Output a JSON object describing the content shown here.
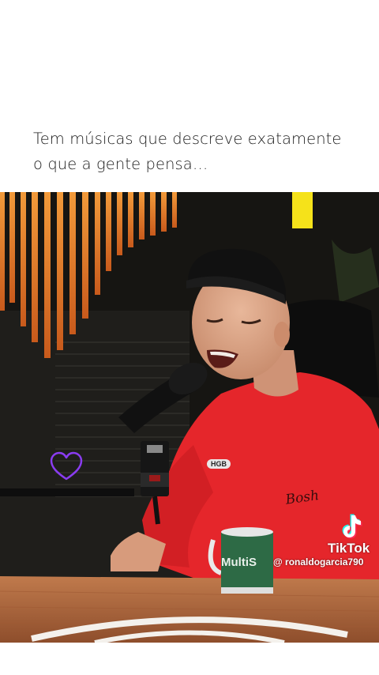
{
  "caption": {
    "line1": "Tem músicas que descreve exatamente",
    "line2": "o que a gente pensa…"
  },
  "video": {
    "watermark_app": "TikTok",
    "watermark_user": "@ ronaldogarcia790",
    "mug_text": "MultiS",
    "cap_logo": "HGB",
    "icons": [
      "tiktok-icon",
      "heart-icon"
    ],
    "colors": {
      "shirt": "#e8272c",
      "slats": "#e0782a",
      "mug": "#2d6a45",
      "table": "#b0683e"
    }
  }
}
